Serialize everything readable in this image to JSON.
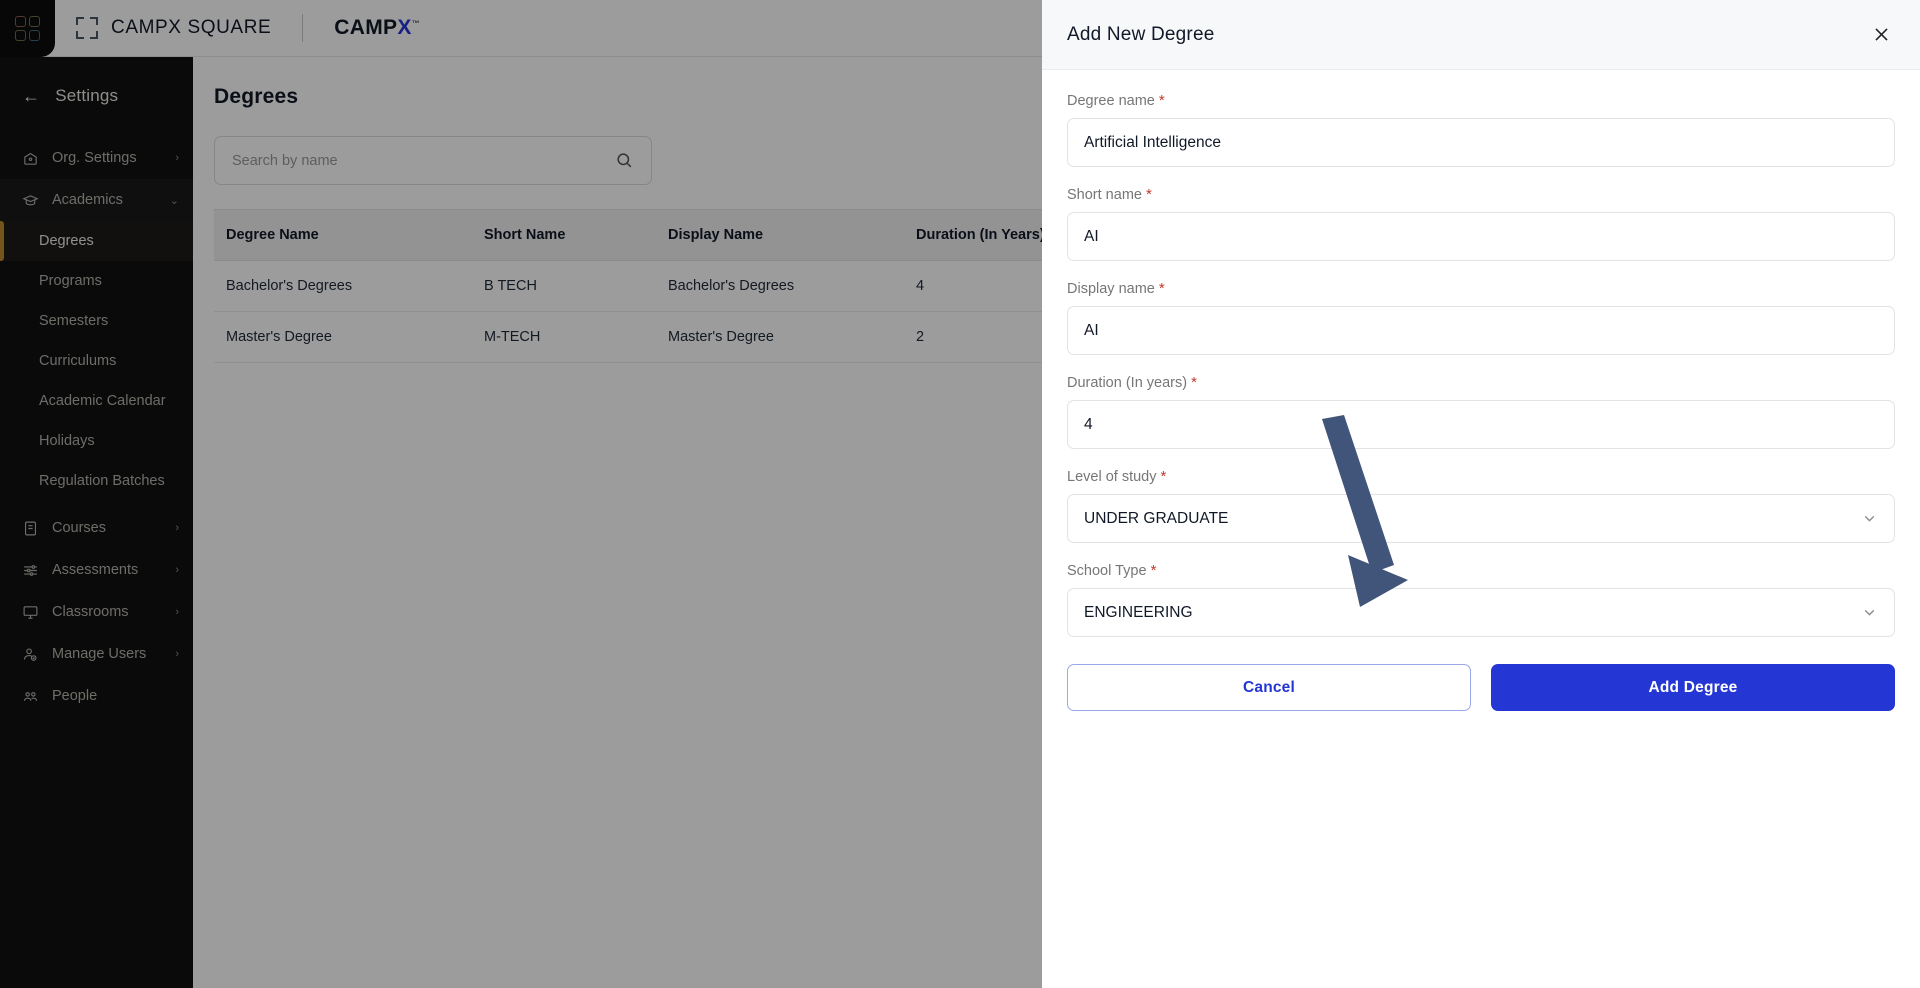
{
  "topbar": {
    "logo_icon": "grid-logo-icon",
    "frame_icon": "expand-frame-icon",
    "product_name": "CAMPX SQUARE",
    "brand_prefix": "CAMP",
    "brand_accent": "X",
    "brand_tm": "™",
    "accent_color": "#2437d4"
  },
  "sidebar": {
    "back_icon": "back-arrow-icon",
    "header": "Settings",
    "active_color": "#c08b2e",
    "groups": [
      {
        "icon": "org-settings-icon",
        "label": "Org. Settings",
        "chevron": "›",
        "expanded": false
      },
      {
        "icon": "academics-cap-icon",
        "label": "Academics",
        "chevron": "⌄",
        "expanded": true
      }
    ],
    "academics_children": [
      {
        "label": "Degrees",
        "active": true
      },
      {
        "label": "Programs",
        "active": false
      },
      {
        "label": "Semesters",
        "active": false
      },
      {
        "label": "Curriculums",
        "active": false
      },
      {
        "label": "Academic Calendar",
        "active": false
      },
      {
        "label": "Holidays",
        "active": false
      },
      {
        "label": "Regulation Batches",
        "active": false
      }
    ],
    "bottom_items": [
      {
        "icon": "courses-doc-icon",
        "label": "Courses",
        "chevron": "›"
      },
      {
        "icon": "assessments-sliders-icon",
        "label": "Assessments",
        "chevron": "›"
      },
      {
        "icon": "classrooms-monitor-icon",
        "label": "Classrooms",
        "chevron": "›"
      },
      {
        "icon": "manage-users-icon",
        "label": "Manage Users",
        "chevron": "›"
      },
      {
        "icon": "people-group-icon",
        "label": "People",
        "chevron": ""
      }
    ]
  },
  "main": {
    "page_title": "Degrees",
    "search": {
      "placeholder": "Search by name",
      "value": "",
      "icon": "search-icon"
    },
    "table": {
      "columns": [
        "Degree Name",
        "Short Name",
        "Display Name",
        "Duration (In Years)"
      ],
      "rows": [
        [
          "Bachelor's Degrees",
          "B TECH",
          "Bachelor's Degrees",
          "4"
        ],
        [
          "Master's Degree",
          "M-TECH",
          "Master's Degree",
          "2"
        ]
      ]
    }
  },
  "panel": {
    "title": "Add New Degree",
    "close_icon": "close-icon",
    "fields": [
      {
        "label": "Degree name",
        "required": "*",
        "value": "Artificial Intelligence",
        "type": "text"
      },
      {
        "label": "Short name",
        "required": "*",
        "value": "AI",
        "type": "text"
      },
      {
        "label": "Display name",
        "required": "*",
        "value": "AI",
        "type": "text"
      },
      {
        "label": "Duration (In years)",
        "required": "*",
        "value": "4",
        "type": "text"
      },
      {
        "label": "Level of study",
        "required": "*",
        "value": "UNDER GRADUATE",
        "type": "select"
      },
      {
        "label": "School Type",
        "required": "*",
        "value": "ENGINEERING",
        "type": "select"
      }
    ],
    "buttons": {
      "cancel": "Cancel",
      "submit": "Add Degree",
      "primary_color": "#2437d4"
    }
  },
  "annotation": {
    "arrow_color": "#41547a",
    "points_to": "Add Degree"
  }
}
